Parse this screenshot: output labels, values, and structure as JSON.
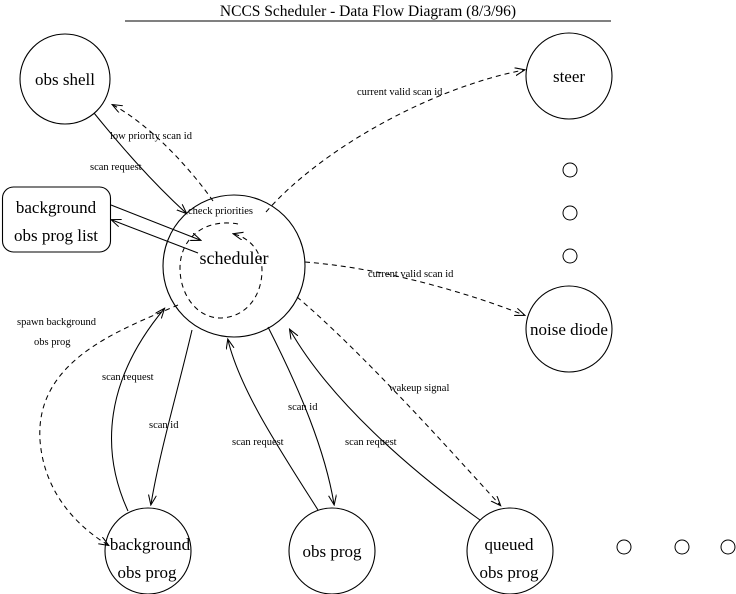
{
  "diagram": {
    "title": "NCCS Scheduler - Data Flow Diagram (8/3/96)",
    "background_color": "#ffffff",
    "line_color": "#000000",
    "nodes": {
      "obs_shell": "obs shell",
      "steer": "steer",
      "noise_diode": "noise diode",
      "scheduler": "scheduler",
      "background_obs_prog_list_line1": "background",
      "background_obs_prog_list_line2": "obs prog list",
      "background_obs_prog_line1": "background",
      "background_obs_prog_line2": "obs prog",
      "obs_prog": "obs prog",
      "queued_obs_prog_line1": "queued",
      "queued_obs_prog_line2": "obs prog"
    },
    "edge_labels": {
      "low_priority_scan_id": "low priority scan id",
      "scan_request_obs_shell": "scan request",
      "current_valid_scan_id_steer": "current valid scan id",
      "current_valid_scan_id_noise_diode": "current valid scan id",
      "check_priorities": "check priorities",
      "spawn_background_line1": "spawn background",
      "spawn_background_line2": "obs prog",
      "scan_request_background": "scan request",
      "scan_id_background": "scan id",
      "scan_request_obs_prog": "scan request",
      "scan_id_obs_prog": "scan id",
      "scan_request_queued": "scan request",
      "wakeup_signal": "wakeup signal"
    }
  }
}
